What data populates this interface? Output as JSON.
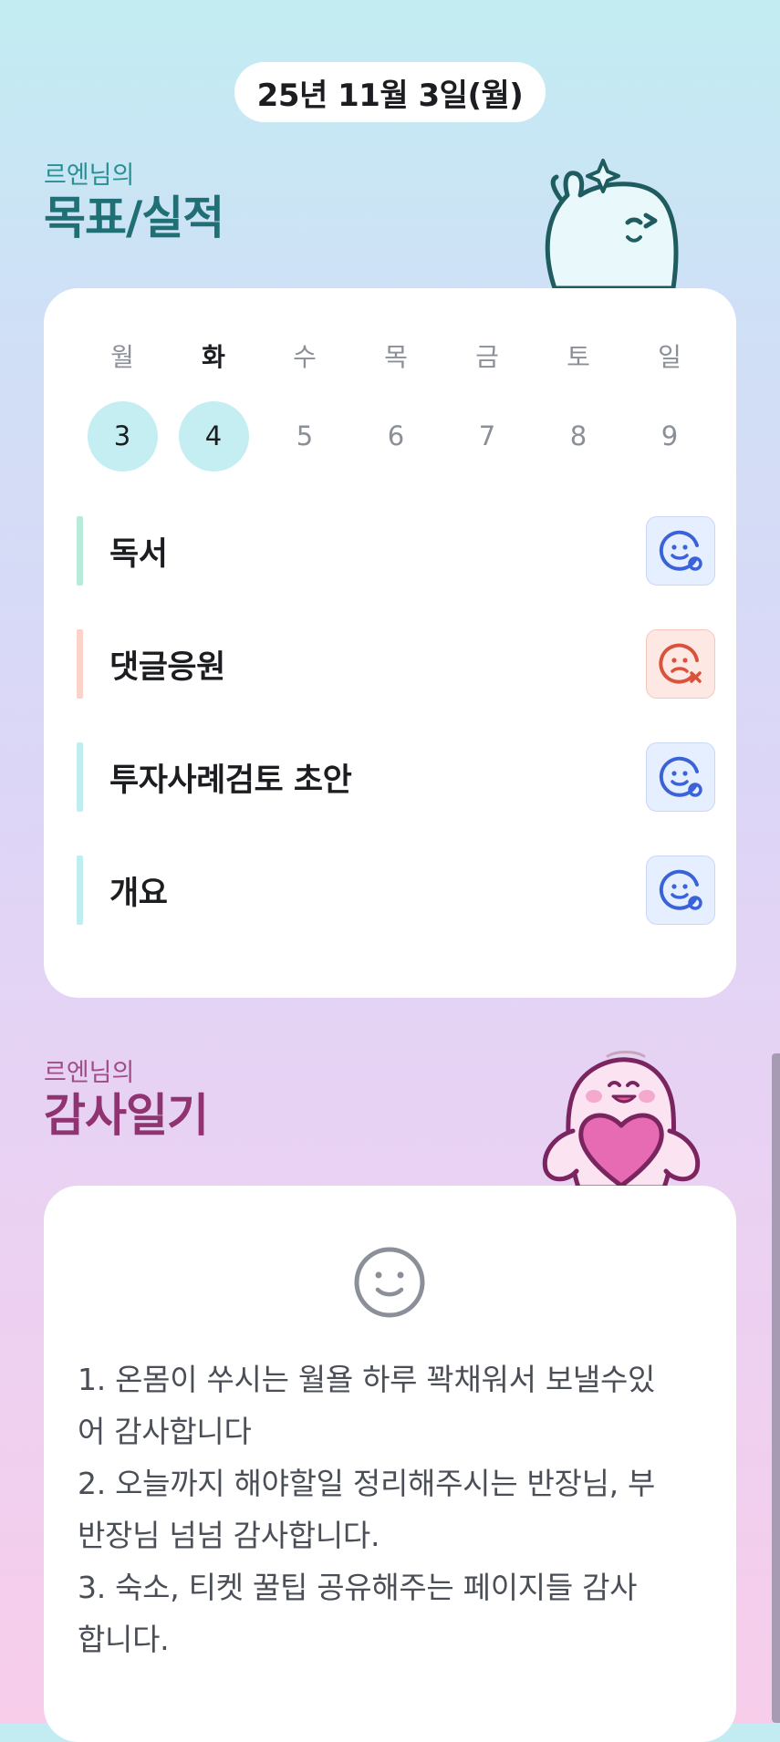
{
  "header": {
    "date": "25년 11월 3일(월)"
  },
  "goals_section": {
    "owner": "르엔님의",
    "title": "목표/실적",
    "weekdays": [
      "월",
      "화",
      "수",
      "목",
      "금",
      "토",
      "일"
    ],
    "dates": [
      "3",
      "4",
      "5",
      "6",
      "7",
      "8",
      "9"
    ],
    "highlighted_dates": [
      "3",
      "4"
    ],
    "items": [
      {
        "label": "독서",
        "bar_color": "#b6ecd9",
        "status": "ok",
        "status_icon": "smile-check-icon"
      },
      {
        "label": "댓글응원",
        "bar_color": "#fbd3cb",
        "status": "fail",
        "status_icon": "sad-x-icon"
      },
      {
        "label": "투자사례검토 초안",
        "bar_color": "#bfeef1",
        "status": "ok",
        "status_icon": "smile-check-icon"
      },
      {
        "label": "개요",
        "bar_color": "#bfeef1",
        "status": "ok",
        "status_icon": "smile-check-icon"
      }
    ]
  },
  "gratitude_section": {
    "owner": "르엔님의",
    "title": "감사일기",
    "mood_icon": "neutral-smile-icon",
    "entry": "1. 온몸이 쑤시는 월욜 하루 꽉채워서 보낼수있\n어 감사합니다\n2. 오늘까지 해야할일 정리해주시는 반장님, 부\n반장님 넘넘 감사합니다.\n3. 숙소, 티켓 꿀팁 공유해주는 페이지들 감사\n합니다."
  },
  "colors": {
    "ok_icon": "#3a63d8",
    "fail_icon": "#d9533b",
    "goal_title": "#1f6f74",
    "gratitude_title": "#8f3371"
  }
}
